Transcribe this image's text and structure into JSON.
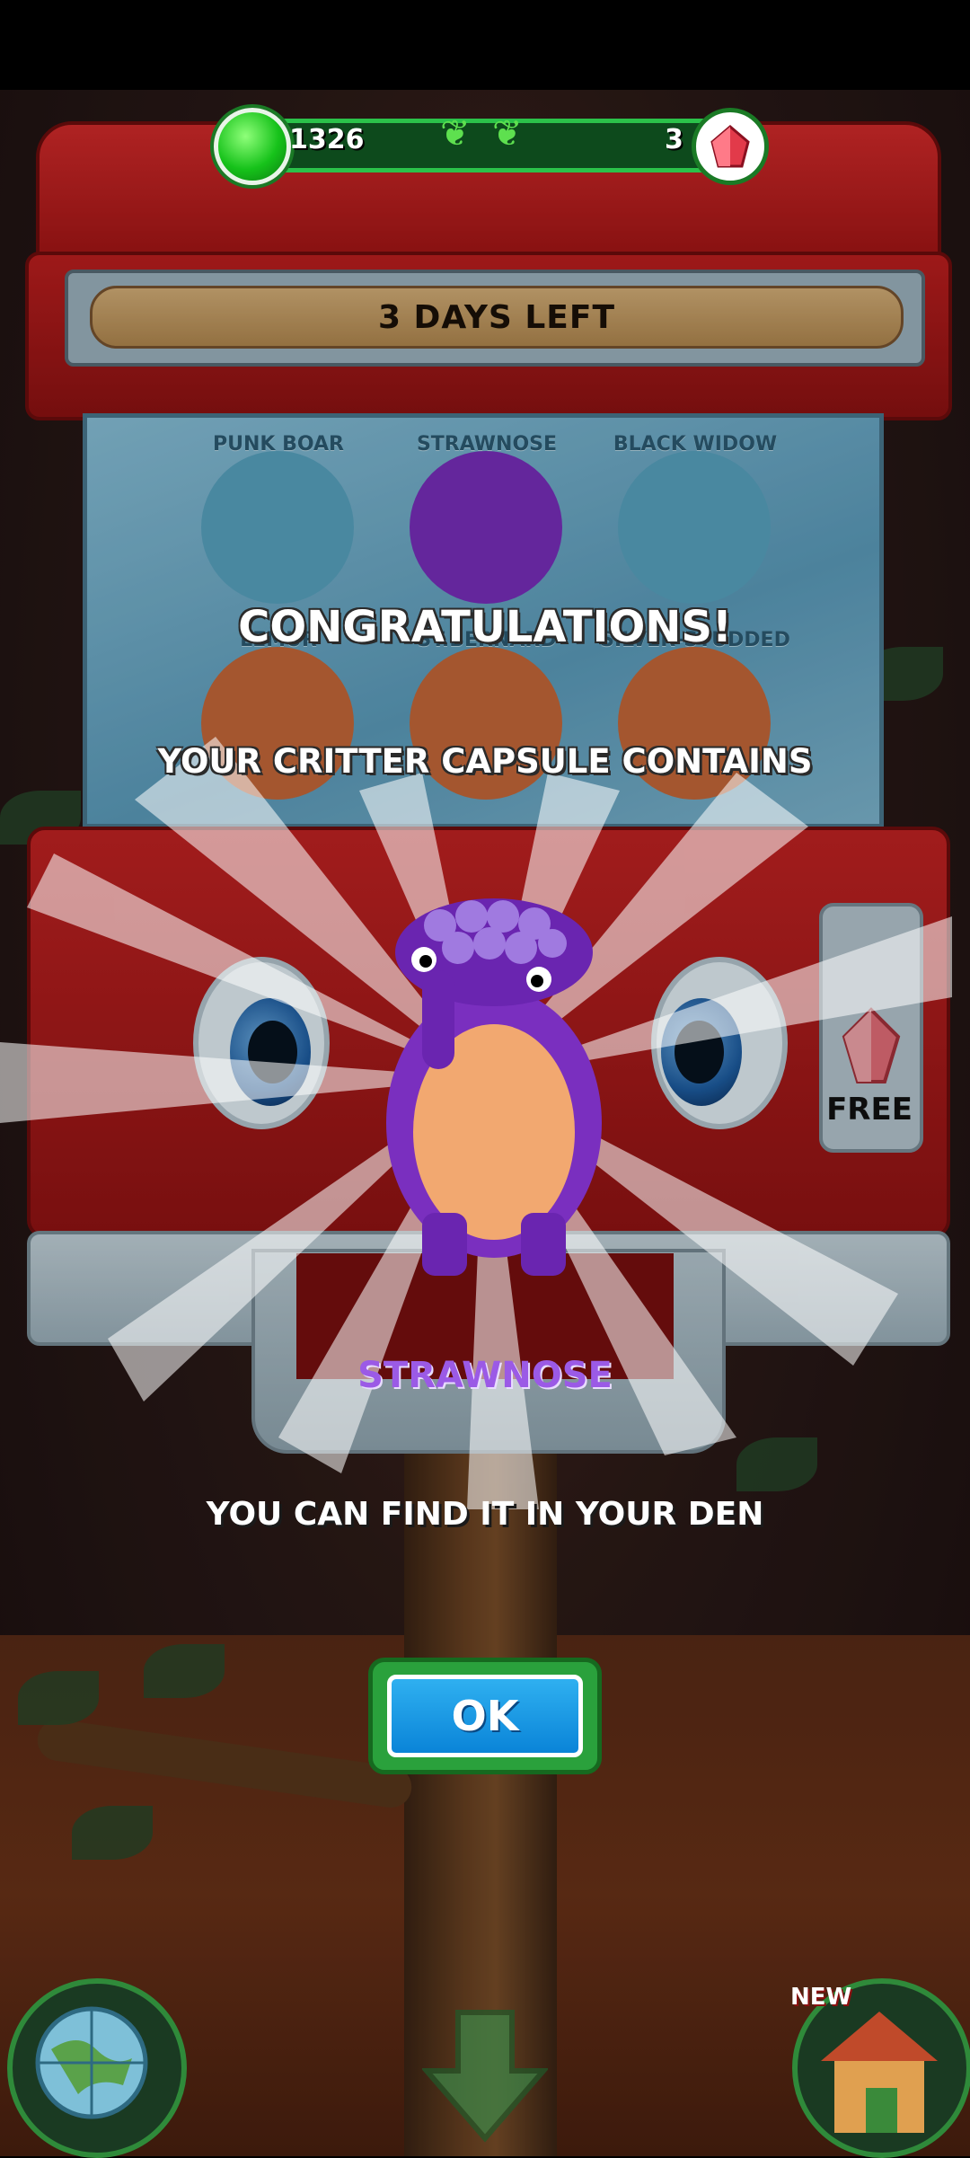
{
  "hud": {
    "green_gem_count": "1326",
    "red_gem_count": "3",
    "green_gem_icon": "green-gem-icon",
    "red_gem_icon": "red-crystal-icon"
  },
  "machine": {
    "timer_text": "3 DAYS LEFT",
    "free_label": "FREE",
    "capsule_critters": [
      {
        "name": "PUNK BOAR",
        "color": "#5aa6c4"
      },
      {
        "name": "STRAWNOSE",
        "color": "#7a2fbf"
      },
      {
        "name": "BLACK WIDOW",
        "color": "#5aa6c4"
      },
      {
        "name": "LEMUR",
        "color": "#c86a3a"
      },
      {
        "name": "ST.BERNARD",
        "color": "#c86a3a"
      },
      {
        "name": "SILVER-STUDDED BLUE",
        "color": "#c86a3a"
      }
    ]
  },
  "reward": {
    "headline": "CONGRATULATIONS!",
    "subline": "YOUR CRITTER CAPSULE CONTAINS",
    "critter_name": "STRAWNOSE",
    "info": "YOU CAN FIND IT IN YOUR DEN",
    "ok_label": "OK"
  },
  "bottom_nav": {
    "globe_icon": "globe-icon",
    "down_icon": "down-arrow-icon",
    "house_icon": "den-house-icon",
    "new_badge": "NEW"
  },
  "colors": {
    "accent_green": "#2bc24a",
    "machine_red": "#c52323",
    "ok_blue": "#0a84d8",
    "critter_purple": "#9b5ae6"
  }
}
